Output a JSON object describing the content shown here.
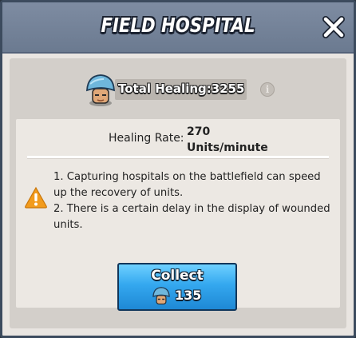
{
  "header": {
    "title": "FIELD HOSPITAL",
    "close_icon": "close-icon"
  },
  "summary": {
    "total_healing_text": "Total Healing:3255",
    "info_icon_glyph": "i"
  },
  "rate": {
    "label": "Healing Rate:",
    "value_line1": "270",
    "value_line2": "Units/minute"
  },
  "notes": {
    "line1": "1. Capturing hospitals on the battlefield can speed up the recovery of units.",
    "line2": "2. There is a certain delay in the display of wounded units."
  },
  "collect": {
    "label": "Collect",
    "amount": "135"
  },
  "colors": {
    "header_bg": "#7e8ca2",
    "button_blue": "#34a8ef",
    "warning_orange": "#f29b1d"
  }
}
